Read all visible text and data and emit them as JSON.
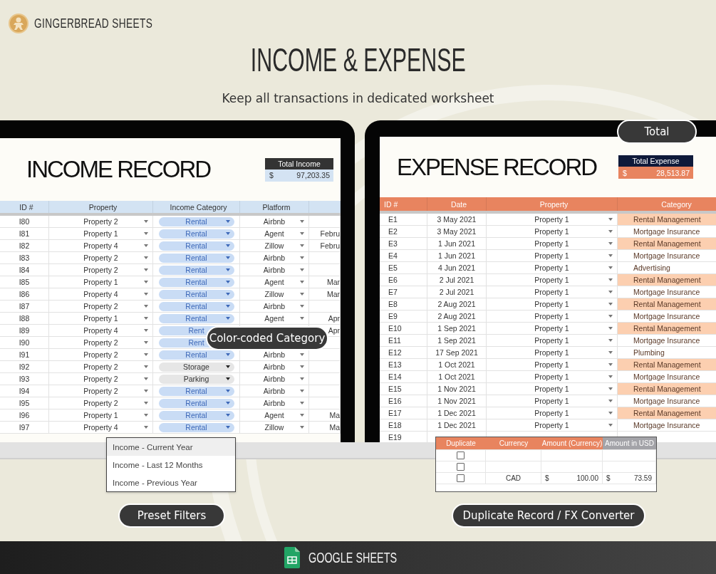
{
  "brand": {
    "name": "GINGERBREAD SHEETS"
  },
  "headline": "INCOME & EXPENSE",
  "subtitle": "Keep all transactions in dedicated worksheet",
  "income_sheet": {
    "title": "INCOME RECORD",
    "total": {
      "label": "Total Income",
      "currency": "$",
      "amount": "97,203.35"
    },
    "columns": [
      "ID #",
      "Property",
      "Income Category",
      "Platform"
    ],
    "rows": [
      {
        "id": "I80",
        "property": "Property 2",
        "category": {
          "label": "Rental",
          "color": "#c9dcf5"
        },
        "platform": "Airbnb"
      },
      {
        "id": "I81",
        "property": "Property 1",
        "category": {
          "label": "Rental",
          "color": "#c9dcf5"
        },
        "platform": "Agent",
        "column_5": "Febru"
      },
      {
        "id": "I82",
        "property": "Property 4",
        "category": {
          "label": "Rental",
          "color": "#c9dcf5"
        },
        "platform": "Zillow",
        "column_5": "Febru"
      },
      {
        "id": "I83",
        "property": "Property 2",
        "category": {
          "label": "Rental",
          "color": "#c9dcf5"
        },
        "platform": "Airbnb"
      },
      {
        "id": "I84",
        "property": "Property 2",
        "category": {
          "label": "Rental",
          "color": "#c9dcf5"
        },
        "platform": "Airbnb"
      },
      {
        "id": "I85",
        "property": "Property 1",
        "category": {
          "label": "Rental",
          "color": "#c9dcf5"
        },
        "platform": "Agent",
        "column_5": "Mar"
      },
      {
        "id": "I86",
        "property": "Property 4",
        "category": {
          "label": "Rental",
          "color": "#c9dcf5"
        },
        "platform": "Zillow",
        "column_5": "Mar"
      },
      {
        "id": "I87",
        "property": "Property 2",
        "category": {
          "label": "Rental",
          "color": "#c9dcf5"
        },
        "platform": "Airbnb"
      },
      {
        "id": "I88",
        "property": "Property 1",
        "category": {
          "label": "Rental",
          "color": "#c9dcf5"
        },
        "platform": "Agent",
        "column_5": "Apr"
      },
      {
        "id": "I89",
        "property": "Property 4",
        "category": {
          "label": "Rent",
          "color": "#c9dcf5"
        },
        "column_5": "Apr"
      },
      {
        "id": "I90",
        "property": "Property 2",
        "category": {
          "label": "Rent",
          "color": "#c9dcf5"
        }
      },
      {
        "id": "I91",
        "property": "Property 2",
        "category": {
          "label": "Rental",
          "color": "#c9dcf5"
        },
        "platform": "Airbnb"
      },
      {
        "id": "I92",
        "property": "Property 2",
        "category": {
          "label": "Storage",
          "color": "#e6e6e6"
        },
        "platform": "Airbnb"
      },
      {
        "id": "I93",
        "property": "Property 2",
        "category": {
          "label": "Parking",
          "color": "#e6e6e6"
        },
        "platform": "Airbnb"
      },
      {
        "id": "I94",
        "property": "Property 2",
        "category": {
          "label": "Rental",
          "color": "#c9dcf5"
        },
        "platform": "Airbnb"
      },
      {
        "id": "I95",
        "property": "Property 2",
        "category": {
          "label": "Rental",
          "color": "#c9dcf5"
        },
        "platform": "Airbnb"
      },
      {
        "id": "I96",
        "property": "Property 1",
        "category": {
          "label": "Rental",
          "color": "#c9dcf5"
        },
        "platform": "Agent",
        "column_5": "Ma"
      },
      {
        "id": "I97",
        "property": "Property 4",
        "category": {
          "label": "Rental",
          "color": "#c9dcf5"
        },
        "platform": "Zillow",
        "column_5": "Ma"
      }
    ]
  },
  "expense_sheet": {
    "title": "EXPENSE RECORD",
    "total": {
      "label": "Total Expense",
      "currency": "$",
      "amount": "28,513.87"
    },
    "columns": [
      "ID #",
      "Date",
      "Property",
      "Category"
    ],
    "rows": [
      {
        "id": "E1",
        "date": "3 May 2021",
        "property": "Property 1",
        "category": {
          "label": "Rental Management",
          "color": "#fccfb0"
        }
      },
      {
        "id": "E2",
        "date": "3 May 2021",
        "property": "Property 1",
        "category": {
          "label": "Mortgage Insurance",
          "color": "#ffffff"
        }
      },
      {
        "id": "E3",
        "date": "1 Jun 2021",
        "property": "Property 1",
        "category": {
          "label": "Rental Management",
          "color": "#fccfb0"
        }
      },
      {
        "id": "E4",
        "date": "1 Jun 2021",
        "property": "Property 1",
        "category": {
          "label": "Mortgage Insurance",
          "color": "#ffffff"
        }
      },
      {
        "id": "E5",
        "date": "4 Jun 2021",
        "property": "Property 1",
        "category": {
          "label": "Advertising",
          "color": "#ffffff"
        }
      },
      {
        "id": "E6",
        "date": "2 Jul 2021",
        "property": "Property 1",
        "category": {
          "label": "Rental Management",
          "color": "#fccfb0"
        }
      },
      {
        "id": "E7",
        "date": "2 Jul 2021",
        "property": "Property 1",
        "category": {
          "label": "Mortgage Insurance",
          "color": "#ffffff"
        }
      },
      {
        "id": "E8",
        "date": "2 Aug 2021",
        "property": "Property 1",
        "category": {
          "label": "Rental Management",
          "color": "#fccfb0"
        }
      },
      {
        "id": "E9",
        "date": "2 Aug 2021",
        "property": "Property 1",
        "category": {
          "label": "Mortgage Insurance",
          "color": "#ffffff"
        }
      },
      {
        "id": "E10",
        "date": "1 Sep 2021",
        "property": "Property 1",
        "category": {
          "label": "Rental Management",
          "color": "#fccfb0"
        }
      },
      {
        "id": "E11",
        "date": "1 Sep 2021",
        "property": "Property 1",
        "category": {
          "label": "Mortgage Insurance",
          "color": "#ffffff"
        }
      },
      {
        "id": "E12",
        "date": "17 Sep 2021",
        "property": "Property 1",
        "category": {
          "label": "Plumbing",
          "color": "#ffffff"
        }
      },
      {
        "id": "E13",
        "date": "1 Oct 2021",
        "property": "Property 1",
        "category": {
          "label": "Rental Management",
          "color": "#fccfb0"
        }
      },
      {
        "id": "E14",
        "date": "1 Oct 2021",
        "property": "Property 1",
        "category": {
          "label": "Mortgage Insurance",
          "color": "#ffffff"
        }
      },
      {
        "id": "E15",
        "date": "1 Nov 2021",
        "property": "Property 1",
        "category": {
          "label": "Rental Management",
          "color": "#fccfb0"
        }
      },
      {
        "id": "E16",
        "date": "1 Nov 2021",
        "property": "Property 1",
        "category": {
          "label": "Mortgage Insurance",
          "color": "#ffffff"
        }
      },
      {
        "id": "E17",
        "date": "1 Dec 2021",
        "property": "Property 1",
        "category": {
          "label": "Rental Management",
          "color": "#fccfb0"
        }
      },
      {
        "id": "E18",
        "date": "1 Dec 2021",
        "property": "Property 1",
        "category": {
          "label": "Mortgage Insurance",
          "color": "#ffffff"
        }
      },
      {
        "id": "E19"
      }
    ]
  },
  "callouts": {
    "total": "Total",
    "category": "Color-coded Category",
    "filters": "Preset Filters",
    "converter": "Duplicate Record / FX Converter"
  },
  "filter_menu": [
    {
      "label": "Income - Current Year",
      "selected": true
    },
    {
      "label": "Income - Last 12 Months",
      "selected": false
    },
    {
      "label": "Income - Previous Year",
      "selected": false
    }
  ],
  "converter_table": {
    "columns": [
      "Duplicate",
      "Currency",
      "Amount (Currency)",
      "Amount in USD"
    ],
    "rows": [
      {
        "checked": false
      },
      {
        "checked": false
      },
      {
        "checked": false,
        "currency": "CAD",
        "amount_currency": "100.00",
        "amount_usd": "73.59",
        "symbol": "$"
      }
    ]
  },
  "footer": {
    "label": "GOOGLE SHEETS"
  }
}
